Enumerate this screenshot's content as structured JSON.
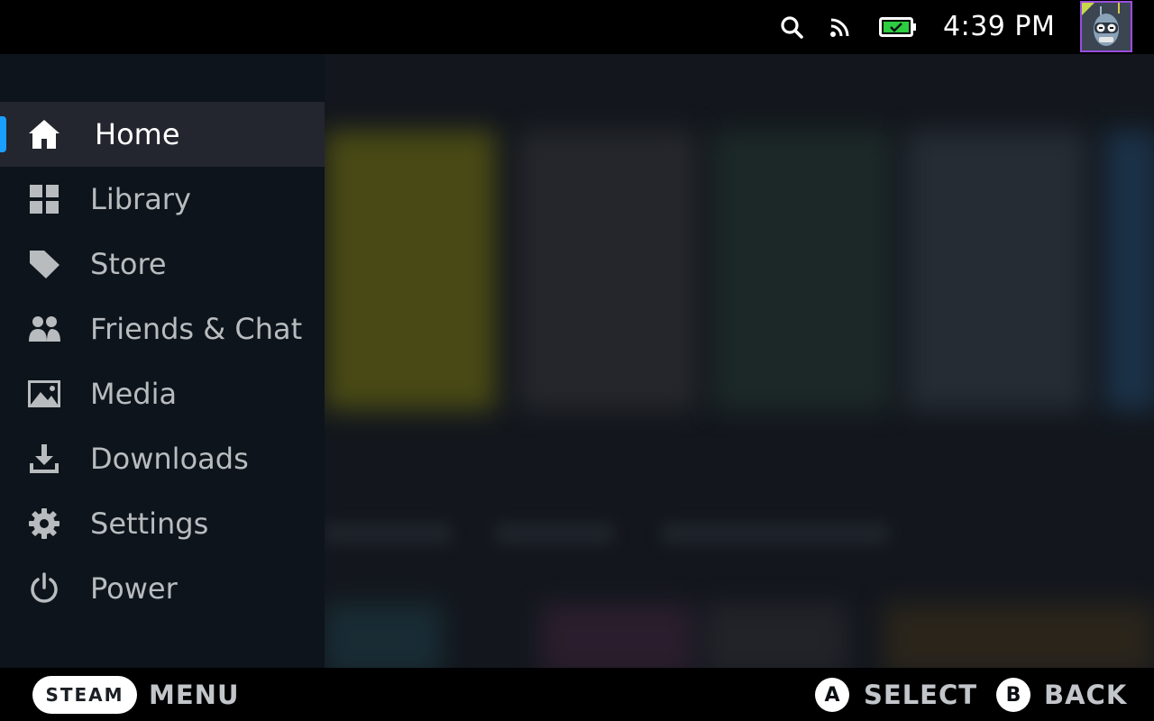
{
  "status_bar": {
    "clock": "4:39 PM",
    "icons": [
      "search-icon",
      "cast-icon",
      "battery-charging-icon"
    ],
    "battery_color": "#2ecc40"
  },
  "colors": {
    "accent": "#1a9fff",
    "sidebar_bg": "#0e141b",
    "active_item_bg": "#23262e",
    "avatar_border": "#9b4de0"
  },
  "sidebar": {
    "items": [
      {
        "label": "Home",
        "icon": "home-icon",
        "active": true
      },
      {
        "label": "Library",
        "icon": "library-grid-icon",
        "active": false
      },
      {
        "label": "Store",
        "icon": "tag-icon",
        "active": false
      },
      {
        "label": "Friends & Chat",
        "icon": "friends-icon",
        "active": false
      },
      {
        "label": "Media",
        "icon": "image-icon",
        "active": false
      },
      {
        "label": "Downloads",
        "icon": "download-icon",
        "active": false
      },
      {
        "label": "Settings",
        "icon": "gear-icon",
        "active": false
      },
      {
        "label": "Power",
        "icon": "power-icon",
        "active": false
      }
    ]
  },
  "bottom_bar": {
    "steam_button": "STEAM",
    "menu_label": "MENU",
    "a_button": "A",
    "select_label": "SELECT",
    "b_button": "B",
    "back_label": "BACK"
  }
}
